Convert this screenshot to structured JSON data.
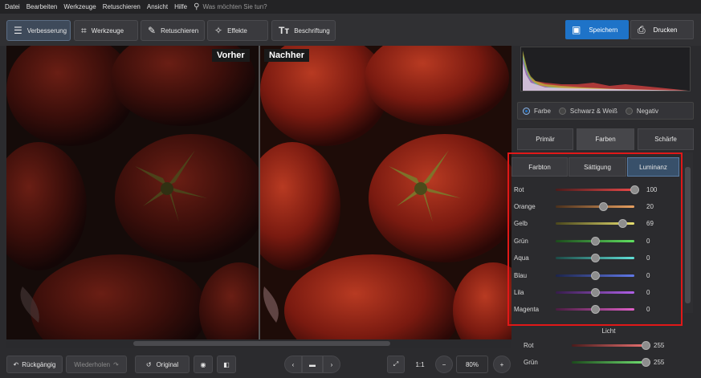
{
  "menu": {
    "items": [
      "Datei",
      "Bearbeiten",
      "Werkzeuge",
      "Retuschieren",
      "Ansicht",
      "Hilfe"
    ],
    "search_placeholder": "Was möchten Sie tun?"
  },
  "toolbar": {
    "tabs": [
      {
        "label": "Verbesserung",
        "icon": "sliders-icon"
      },
      {
        "label": "Werkzeuge",
        "icon": "crop-icon"
      },
      {
        "label": "Retuschieren",
        "icon": "brush-icon"
      },
      {
        "label": "Effekte",
        "icon": "magic-wand-icon"
      },
      {
        "label": "Beschriftung",
        "icon": "text-icon"
      }
    ],
    "save_label": "Speichern",
    "print_label": "Drucken"
  },
  "viewer": {
    "before_label": "Vorher",
    "after_label": "Nachher"
  },
  "bottom": {
    "undo_label": "Rückgängig",
    "redo_label": "Wiederholen",
    "original_label": "Original",
    "one_to_one": "1:1",
    "zoom": "80%"
  },
  "panel": {
    "modes": [
      {
        "label": "Farbe",
        "selected": true
      },
      {
        "label": "Schwarz & Weiß",
        "selected": false
      },
      {
        "label": "Negativ",
        "selected": false
      }
    ],
    "tabs": [
      "Primär",
      "Farben",
      "Schärfe"
    ],
    "active_tab": "Farben",
    "subtabs": [
      "Farbton",
      "Sättigung",
      "Luminanz"
    ],
    "active_subtab": "Luminanz",
    "sliders": [
      {
        "name": "Rot",
        "value": "100",
        "fraction": 1.0,
        "from": "#4a1c1c",
        "to": "#e84848"
      },
      {
        "name": "Orange",
        "value": "20",
        "fraction": 0.6,
        "from": "#4a301c",
        "to": "#e8a060"
      },
      {
        "name": "Gelb",
        "value": "69",
        "fraction": 0.85,
        "from": "#4a461c",
        "to": "#e8e070"
      },
      {
        "name": "Grün",
        "value": "0",
        "fraction": 0.5,
        "from": "#1c4a1c",
        "to": "#60e060"
      },
      {
        "name": "Aqua",
        "value": "0",
        "fraction": 0.5,
        "from": "#1c4a46",
        "to": "#60e0d8"
      },
      {
        "name": "Blau",
        "value": "0",
        "fraction": 0.5,
        "from": "#1c244a",
        "to": "#6078e8"
      },
      {
        "name": "Lila",
        "value": "0",
        "fraction": 0.5,
        "from": "#361c4a",
        "to": "#b060e8"
      },
      {
        "name": "Magenta",
        "value": "0",
        "fraction": 0.5,
        "from": "#4a1c40",
        "to": "#e060c8"
      }
    ],
    "licht_label": "Licht",
    "licht_sliders": [
      {
        "name": "Rot",
        "value": "255",
        "fraction": 1.0,
        "from": "#4a1c1c",
        "to": "#e87070"
      },
      {
        "name": "Grün",
        "value": "255",
        "fraction": 1.0,
        "from": "#1c4a1c",
        "to": "#70e070"
      }
    ]
  },
  "colors": {
    "accent": "#1e73c8",
    "highlight_box": "#e01818"
  }
}
